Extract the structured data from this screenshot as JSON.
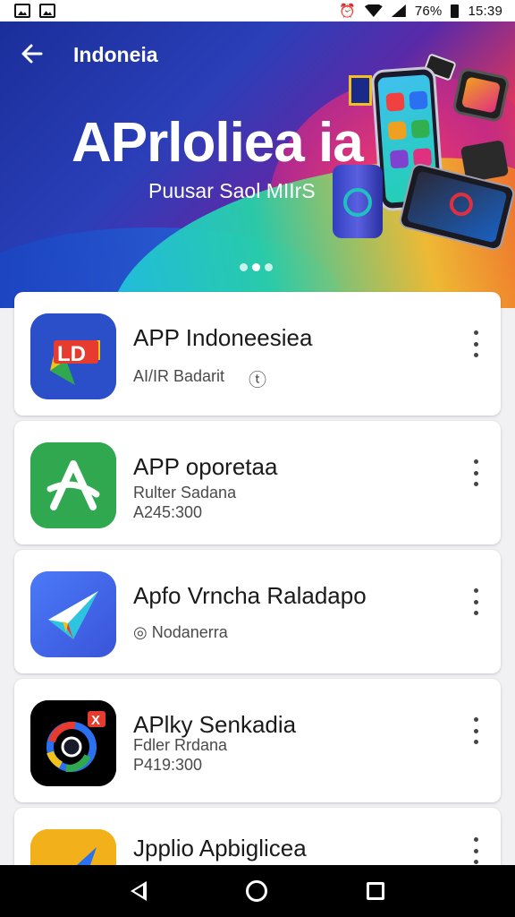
{
  "status_bar": {
    "battery_pct": "76%",
    "time": "15:39",
    "left_icons": [
      "gallery-icon",
      "image-icon"
    ],
    "right_icons": [
      "alarm-icon",
      "wifi-icon",
      "signal-icon",
      "battery-icon"
    ]
  },
  "header": {
    "back_icon": "arrow-left-icon",
    "title": "Indoneia"
  },
  "hero": {
    "title": "APrloliea ia",
    "subtitle": "Puusar Saol MIIrS",
    "page_count": 3,
    "active_page": 2
  },
  "apps": [
    {
      "name": "APP Indoneesiea",
      "line1": "AI/IR Badarit",
      "line2": "",
      "badge": "ⓣ",
      "more_icon": "more-vert-icon"
    },
    {
      "name": "APP oporetaa",
      "line1": "Rulter Sadana",
      "line2": "A245:300",
      "more_icon": "more-vert-icon"
    },
    {
      "name": "Apfo Vrncha Raladapo",
      "line1": "◎ Nodanerra",
      "line2": "",
      "more_icon": "more-vert-icon"
    },
    {
      "name": "APlky Senkadia",
      "line1": "Fdler Rrdana",
      "line2": "P419:300",
      "more_icon": "more-vert-icon"
    },
    {
      "name": "Jpplio Apbiglicea",
      "line1": "",
      "line2": "",
      "more_icon": "more-vert-icon"
    }
  ],
  "nav": {
    "back": "nav-back-icon",
    "home": "nav-home-icon",
    "recent": "nav-recent-icon"
  }
}
